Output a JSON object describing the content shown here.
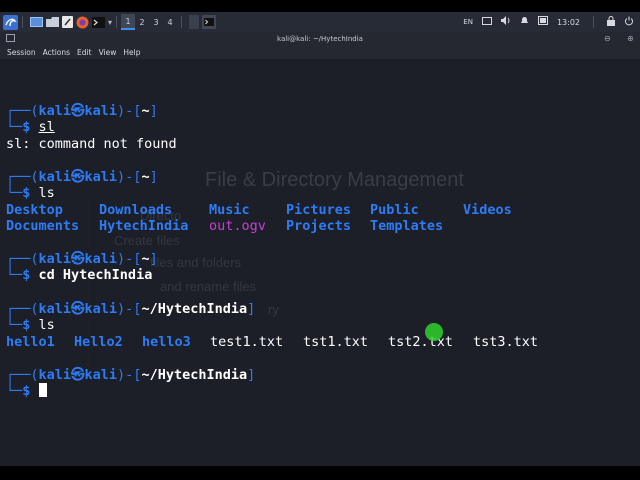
{
  "panel": {
    "workspaces": [
      "1",
      "2",
      "3",
      "4"
    ],
    "active_workspace": "1",
    "language": "EN",
    "clock": "13:02",
    "app_icons": [
      "kali-menu-icon",
      "desktop-icon",
      "files-icon",
      "text-editor-icon",
      "firefox-icon",
      "terminal-icon",
      "terminal-task-icon"
    ]
  },
  "window": {
    "title": "kali@kali: ~/HytechIndia",
    "menu": [
      "Session",
      "Actions",
      "Edit",
      "View",
      "Help"
    ]
  },
  "terminal": {
    "user": "kali",
    "at": "㉿",
    "host": "kali",
    "home": "~",
    "dir": "~/HytechIndia",
    "cmd1": "sl",
    "err1": "sl: command not found",
    "cmd2": "ls",
    "ls1_row1": [
      "Desktop",
      "Downloads",
      "Music",
      "Pictures",
      "Public",
      "Videos"
    ],
    "ls1_row2": [
      "Documents",
      "HytechIndia",
      "out.ogv",
      "Projects",
      "Templates"
    ],
    "cmd3": "cd HytechIndia",
    "cmd4": "ls",
    "ls2_dirs": [
      "hello1",
      "Hello2",
      "hello3"
    ],
    "ls2_files": [
      "test1.txt",
      "tst1.txt",
      "tst2.txt",
      "tst3.txt"
    ]
  },
  "background_overlay": {
    "title": "File & Directory Management",
    "items": [
      "Directo",
      "Create files",
      "files and folders",
      "and rename files",
      "ry"
    ]
  },
  "colors": {
    "prompt": "#2e7cf5",
    "directory": "#2e7cf5",
    "media": "#c93fd6",
    "pointer": "#2ed12e"
  }
}
